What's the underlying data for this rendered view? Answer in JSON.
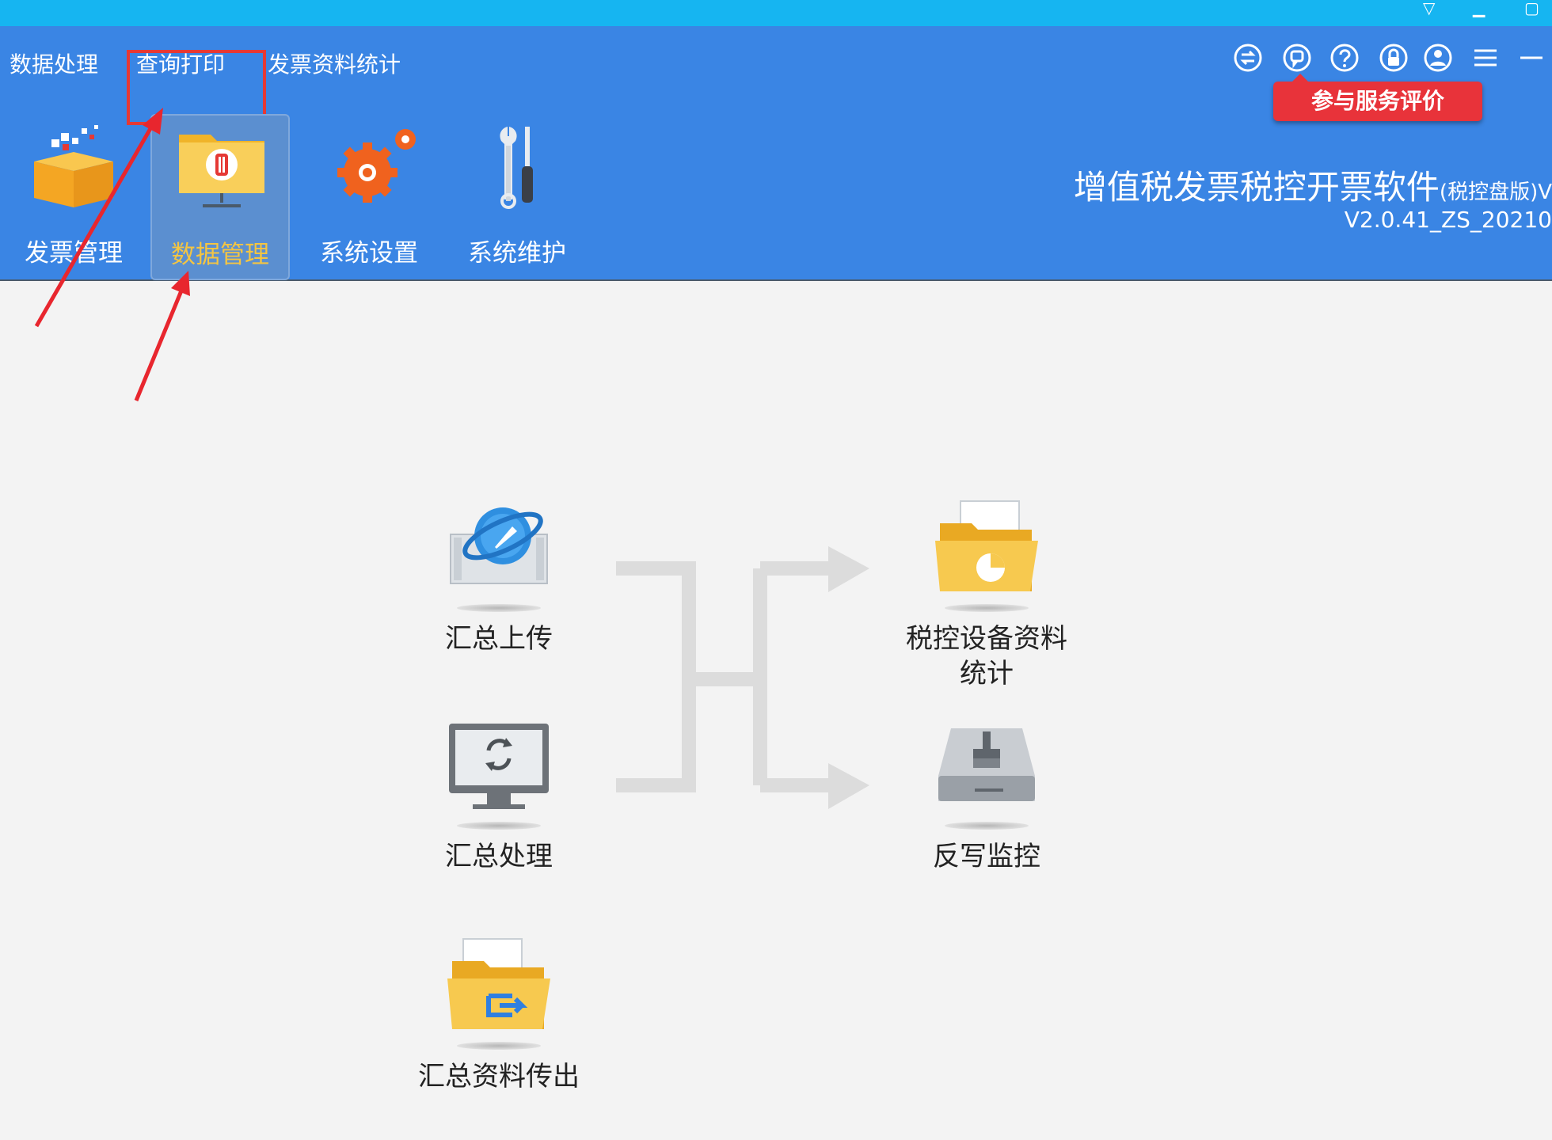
{
  "menu": [
    {
      "label": "数据处理"
    },
    {
      "label": "查询打印"
    },
    {
      "label": "发票资料统计"
    }
  ],
  "top_icons": [
    "exchange-icon",
    "feedback-icon",
    "help-icon",
    "lock-icon",
    "user-icon",
    "menu-icon",
    "minimize-icon"
  ],
  "rate_button": "参与服务评价",
  "toolbar": [
    {
      "label": "发票管理",
      "icon": "invoice-box-icon"
    },
    {
      "label": "数据管理",
      "icon": "data-folder-icon"
    },
    {
      "label": "系统设置",
      "icon": "gear-icon"
    },
    {
      "label": "系统维护",
      "icon": "wrench-screwdriver-icon"
    }
  ],
  "app": {
    "title": "增值税发票税控开票软件",
    "title_suffix": "(税控盘版)V",
    "version": "V2.0.41_ZS_20210"
  },
  "functions": {
    "summary_upload": "汇总上传",
    "summary_process": "汇总处理",
    "summary_export": "汇总资料传出",
    "device_stats": "税控设备资料统计",
    "reverse_write": "反写监控"
  },
  "colors": {
    "title_strip": "#16b5f1",
    "header": "#3a85e4",
    "active_label": "#f4c542",
    "highlight": "#e53935",
    "rate_button": "#e8333a",
    "background": "#f3f3f3"
  }
}
